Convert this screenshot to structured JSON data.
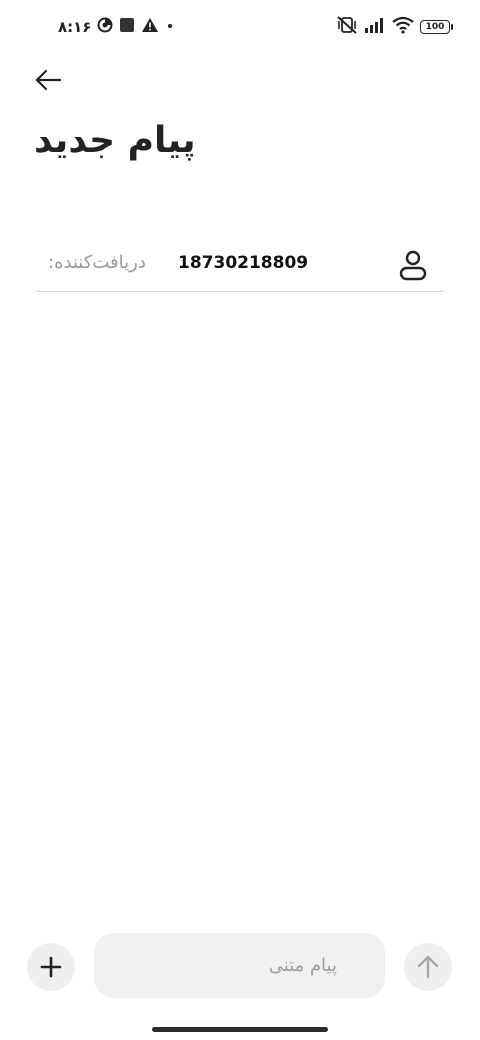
{
  "status_bar": {
    "time": "۸:۱۶",
    "battery": "100"
  },
  "header": {
    "title": "پیام جدید"
  },
  "recipient": {
    "label": "دریافت‌کننده:",
    "value": "18730218809"
  },
  "composer": {
    "placeholder": "پیام متنی"
  },
  "icons": {
    "back": "arrow-left-icon",
    "contact": "person-icon",
    "add": "plus-icon",
    "send": "arrow-up-icon"
  },
  "colors": {
    "text": "#222222",
    "muted": "#9a9a9a",
    "field_bg": "#f0f0f0",
    "divider": "#d9d9d9"
  }
}
